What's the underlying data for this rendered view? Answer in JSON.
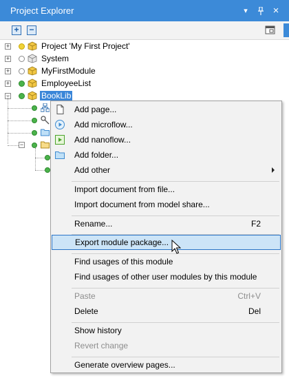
{
  "window": {
    "title": "Project Explorer",
    "controls": {
      "dropdown": "▾",
      "pin": "🖈",
      "close": "×"
    }
  },
  "toolbar": {
    "expand_label": "+",
    "collapse_label": "−"
  },
  "tree": {
    "items": [
      {
        "label": "Project 'My First Project'",
        "status": "yellow"
      },
      {
        "label": "System",
        "status": "hollow"
      },
      {
        "label": "MyFirstModule",
        "status": "hollow"
      },
      {
        "label": "EmployeeList",
        "status": "green"
      },
      {
        "label": "BookLib",
        "status": "green",
        "selected": true
      }
    ]
  },
  "menu": {
    "items": [
      {
        "label": "Add page...",
        "icon": "page-icon"
      },
      {
        "label": "Add microflow...",
        "icon": "microflow-icon"
      },
      {
        "label": "Add nanoflow...",
        "icon": "nanoflow-icon"
      },
      {
        "label": "Add folder...",
        "icon": "folder-icon"
      },
      {
        "label": "Add other",
        "submenu": true
      },
      {
        "label": "Import document from file..."
      },
      {
        "label": "Import document from model share..."
      },
      {
        "label": "Rename...",
        "shortcut": "F2"
      },
      {
        "label": "Export module package...",
        "highlighted": true
      },
      {
        "label": "Find usages of this module"
      },
      {
        "label": "Find usages of other user modules by this module"
      },
      {
        "label": "Paste",
        "shortcut": "Ctrl+V",
        "disabled": true
      },
      {
        "label": "Delete",
        "shortcut": "Del"
      },
      {
        "label": "Show history"
      },
      {
        "label": "Revert change",
        "disabled": true
      },
      {
        "label": "Generate overview pages..."
      }
    ]
  },
  "colors": {
    "accent": "#3c8ad8",
    "highlight_bg": "#cce4f7",
    "highlight_border": "#2a74c7",
    "status_green": "#4bb34b",
    "status_yellow": "#f0d23a"
  }
}
